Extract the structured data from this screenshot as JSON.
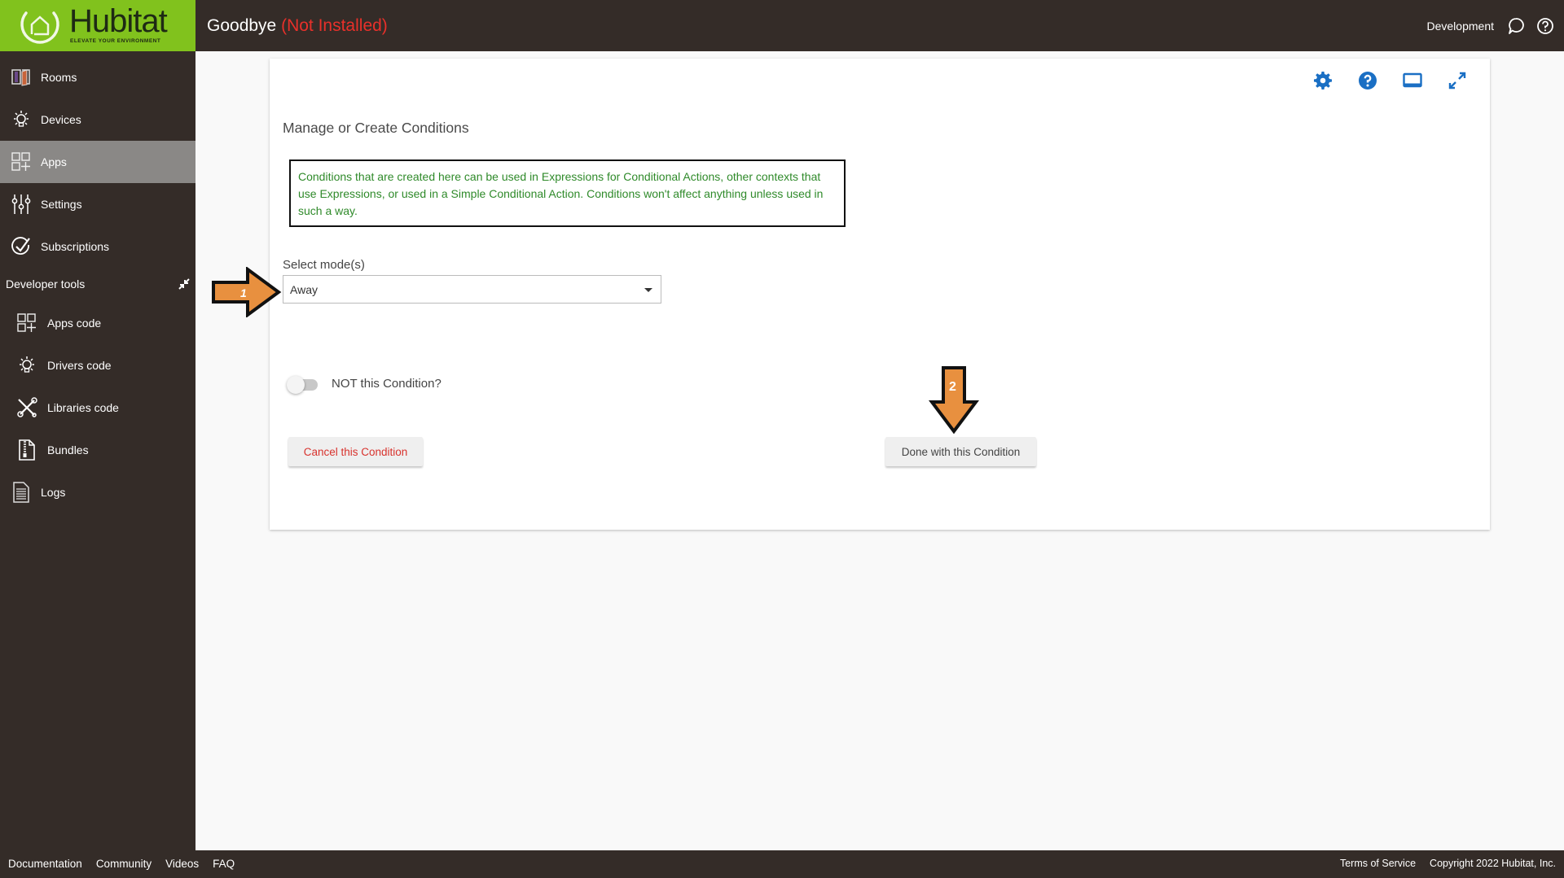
{
  "header": {
    "logo_word": "Hubitat",
    "logo_tagline": "ELEVATE YOUR ENVIRONMENT",
    "title": "Goodbye",
    "status": "(Not Installed)",
    "environment": "Development",
    "icons": [
      "chat-bubble-icon",
      "help-circle-icon"
    ]
  },
  "sidebar": {
    "items": [
      {
        "label": "Rooms",
        "icon": "rooms-icon",
        "active": false
      },
      {
        "label": "Devices",
        "icon": "lightbulb-icon",
        "active": false
      },
      {
        "label": "Apps",
        "icon": "apps-grid-icon",
        "active": true
      },
      {
        "label": "Settings",
        "icon": "sliders-icon",
        "active": false
      },
      {
        "label": "Subscriptions",
        "icon": "check-circle-icon",
        "active": false
      }
    ],
    "dev_tools_label": "Developer tools",
    "dev_items": [
      {
        "label": "Apps code",
        "icon": "apps-grid-icon"
      },
      {
        "label": "Drivers code",
        "icon": "lightbulb-icon"
      },
      {
        "label": "Libraries code",
        "icon": "tools-icon"
      },
      {
        "label": "Bundles",
        "icon": "zip-file-icon"
      },
      {
        "label": "Logs",
        "icon": "document-icon"
      }
    ]
  },
  "card": {
    "tools": [
      "gear-icon",
      "help-icon",
      "display-icon",
      "expand-icon"
    ],
    "title": "Manage or Create Conditions",
    "info_text": "Conditions that are created here can be used in Expressions for Conditional Actions, other contexts that use Expressions, or used in a Simple Conditional Action.  Conditions won't affect anything unless used in such a way.",
    "select_label": "Select mode(s)",
    "select_value": "Away",
    "toggle_label": "NOT this Condition?",
    "toggle_on": false,
    "cancel_label": "Cancel this Condition",
    "done_label": "Done with this Condition"
  },
  "annotations": {
    "arrow1_label": "1",
    "arrow2_label": "2",
    "color": "#e8903f"
  },
  "footer": {
    "links": [
      "Documentation",
      "Community",
      "Videos",
      "FAQ"
    ],
    "terms": "Terms of Service",
    "copyright": "Copyright 2022 Hubitat, Inc."
  },
  "colors": {
    "brand_green": "#81c21d",
    "chrome": "#342c28",
    "accent_blue": "#1a6fc4",
    "info_green": "#2f8a2a",
    "danger_red": "#d8322d"
  }
}
